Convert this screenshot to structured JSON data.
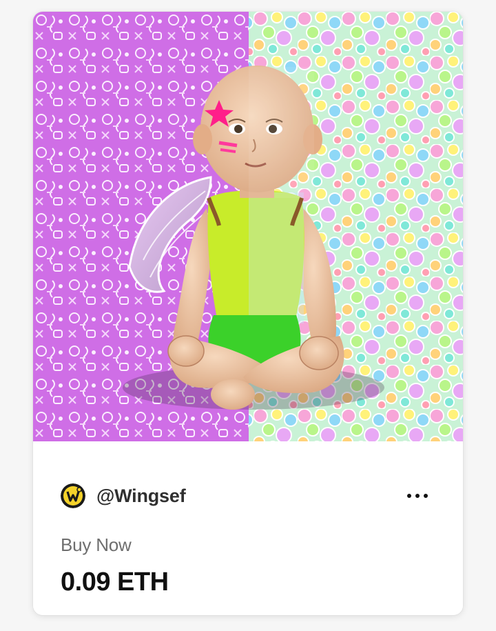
{
  "nft_card": {
    "artwork": {
      "alt": "Angel baby artwork",
      "icon": "nft-artwork-image"
    },
    "creator": {
      "handle": "@Wingsef",
      "avatar_icon": "creator-avatar-logo",
      "avatar_colors": [
        "#f4d22a",
        "#1a1a1a"
      ]
    },
    "more_icon": "more-options-icon",
    "sale_type": "Buy Now",
    "price": "0.09 ETH"
  },
  "colors": {
    "background": "#f6f6f6",
    "card": "#ffffff",
    "text_primary": "#111111",
    "text_secondary": "#6e6e6e",
    "art_left_doodle": "#cf6ee6",
    "art_right_bubbles": "#b8f0c8"
  }
}
